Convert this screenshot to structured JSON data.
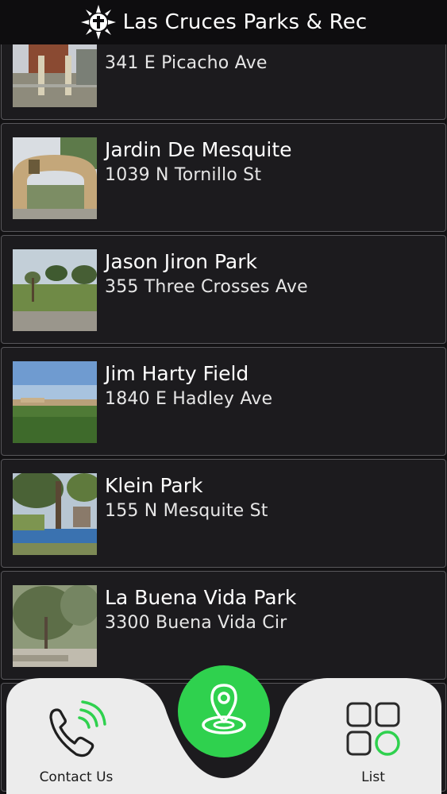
{
  "header": {
    "title": "Las Cruces Parks & Rec",
    "logo_icon": "sun-cross-logo"
  },
  "parks": [
    {
      "name": "",
      "address": "341 E Picacho Ave"
    },
    {
      "name": "Jardin De Mesquite",
      "address": "1039 N Tornillo St"
    },
    {
      "name": "Jason Jiron Park",
      "address": "355 Three Crosses Ave"
    },
    {
      "name": "Jim Harty Field",
      "address": "1840 E Hadley Ave"
    },
    {
      "name": "Klein Park",
      "address": "155 N Mesquite St"
    },
    {
      "name": "La Buena Vida Park",
      "address": "3300 Buena Vida Cir"
    },
    {
      "name": "",
      "address": ""
    }
  ],
  "nav": {
    "contact_label": "Contact Us",
    "list_label": "List",
    "map_icon": "map-pin-icon",
    "accent_color": "#2fd14e"
  }
}
